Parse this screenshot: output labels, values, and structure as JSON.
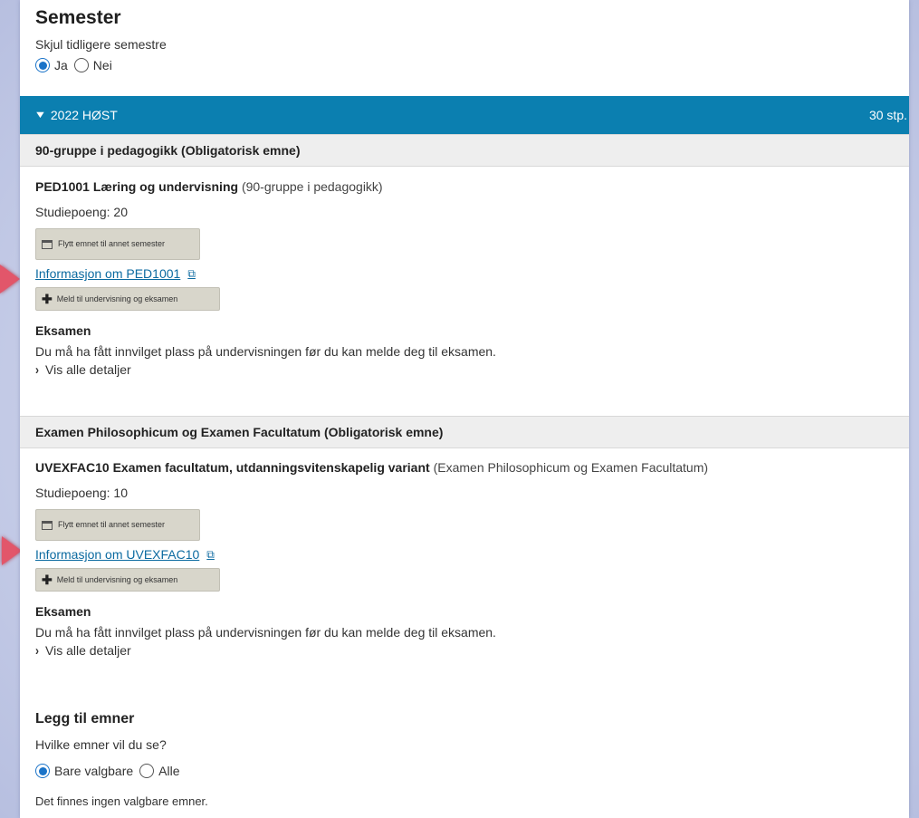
{
  "semester_section": {
    "title": "Semester",
    "hide_previous_label": "Skjul tidligere semestre",
    "options": [
      {
        "label": "Ja",
        "selected": true
      },
      {
        "label": "Nei",
        "selected": false
      }
    ]
  },
  "semester_bar": {
    "label": "2022 HØST",
    "credits": "30 stp.",
    "color": "#0b7fb0"
  },
  "groups": [
    {
      "title": "90-gruppe i pedagogikk (Obligatorisk emne)",
      "course": {
        "code_name": "PED1001 Læring og undervisning",
        "group_ref": "(90-gruppe i pedagogikk)",
        "credits": "Studiepoeng: 20",
        "move_button": "Flytt emnet til annet semester",
        "info_link": "Informasjon om PED1001",
        "register_button": "Meld til undervisning og eksamen",
        "exam_heading": "Eksamen",
        "exam_text": "Du må ha fått innvilget plass på undervisningen før du kan melde deg til eksamen.",
        "details_toggle": "Vis alle detaljer"
      }
    },
    {
      "title": "Examen Philosophicum og Examen Facultatum (Obligatorisk emne)",
      "course": {
        "code_name": "UVEXFAC10 Examen facultatum, utdanningsvitenskapelig variant",
        "group_ref": "(Examen Philosophicum og Examen Facultatum)",
        "credits": "Studiepoeng: 10",
        "move_button": "Flytt emnet til annet semester",
        "info_link": "Informasjon om UVEXFAC10",
        "register_button": "Meld til undervisning og eksamen",
        "exam_heading": "Eksamen",
        "exam_text": "Du må ha fått innvilget plass på undervisningen før du kan melde deg til eksamen.",
        "details_toggle": "Vis alle detaljer"
      }
    }
  ],
  "add_courses": {
    "title": "Legg til emner",
    "question": "Hvilke emner vil du se?",
    "options": [
      {
        "label": "Bare valgbare",
        "selected": true
      },
      {
        "label": "Alle",
        "selected": false
      }
    ],
    "empty_text": "Det finnes ingen valgbare emner."
  },
  "icons": {
    "collapse": "chevron-down-icon",
    "expand": "chevron-right-icon",
    "calendar": "calendar-icon",
    "external": "external-link-icon",
    "add": "plus-icon"
  }
}
